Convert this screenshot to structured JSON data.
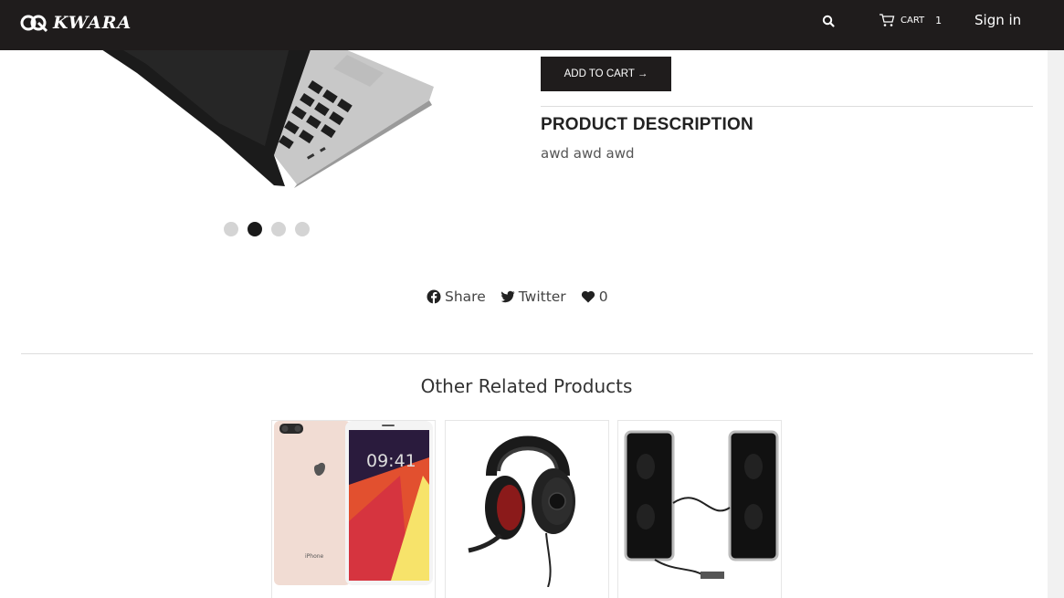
{
  "nav": {
    "brand": "KWARA",
    "cart_label": "CART",
    "cart_count": "1",
    "signin_label": "Sign in"
  },
  "product": {
    "add_to_cart_label": "ADD TO CART →",
    "description_title": "PRODUCT DESCRIPTION",
    "description_text": "awd awd awd",
    "carousel": {
      "count": 4,
      "active_index": 1
    }
  },
  "social": {
    "share_label": "Share",
    "twitter_label": "Twitter",
    "likes": "0"
  },
  "related": {
    "title": "Other Related Products",
    "items": [
      {
        "icon": "iphone-image"
      },
      {
        "icon": "headset-image"
      },
      {
        "icon": "speakers-image"
      }
    ]
  },
  "colors": {
    "nav_bg": "#1f1c1c",
    "button_bg": "#1f1c1c",
    "dot_active": "#1a1a1a",
    "dot_inactive": "#d4d4d4"
  }
}
